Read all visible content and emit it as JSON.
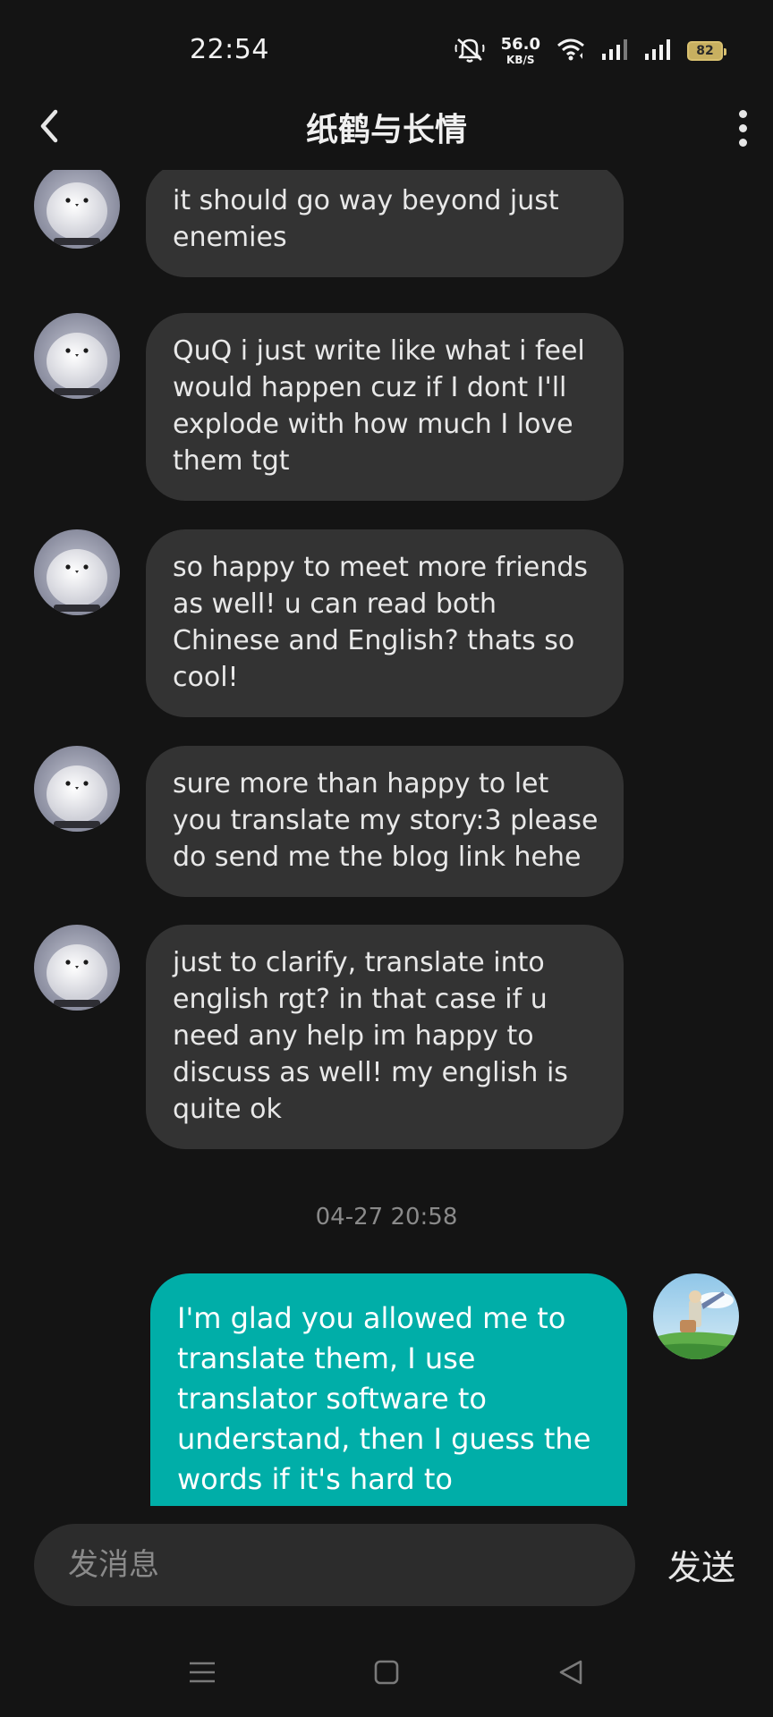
{
  "status_bar": {
    "time": "22:54",
    "net_speed_value": "56.0",
    "net_speed_unit": "KB/S",
    "battery": "82",
    "icons": [
      "mute-icon",
      "wifi-icon",
      "signal-icon",
      "signal-icon",
      "battery-icon"
    ]
  },
  "header": {
    "title": "纸鹤与长情",
    "back_icon": "chevron-left-icon",
    "more_icon": "more-vertical-icon"
  },
  "messages": [
    {
      "direction": "incoming",
      "text": "it should go way beyond just enemies"
    },
    {
      "direction": "incoming",
      "text": "QuQ i just write like what i feel would happen cuz if I dont I'll explode with how much I love them tgt"
    },
    {
      "direction": "incoming",
      "text": "so happy to meet more friends as well! u can read both Chinese and English? thats so cool!"
    },
    {
      "direction": "incoming",
      "text": "sure more than happy to let you translate my story:3 please do send me the blog link hehe"
    },
    {
      "direction": "incoming",
      "text": "just to clarify, translate into english rgt? in that case if u need any help im happy to discuss as well! my english is quite ok"
    },
    {
      "direction": "outgoing",
      "text": "I'm glad you allowed me to translate them, I use translator software to understand, then I guess the words if it's hard to understand and then check it"
    }
  ],
  "timestamp": "04-27 20:58",
  "input": {
    "placeholder": "发消息",
    "value": "",
    "send_label": "发送"
  },
  "nav": {
    "icons": [
      "menu-icon",
      "home-square-icon",
      "back-triangle-icon"
    ]
  },
  "colors": {
    "background": "#141414",
    "incoming_bubble": "#333333",
    "outgoing_bubble": "#00aea8",
    "text": "#e8e8e8",
    "muted": "#8a8a8a"
  }
}
